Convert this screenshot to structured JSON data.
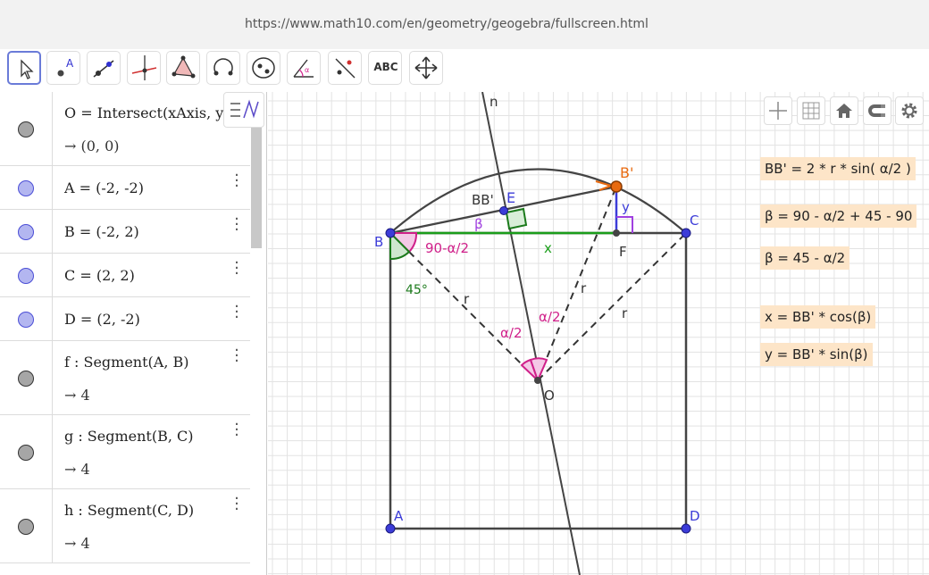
{
  "browser": {
    "url": "https://www.math10.com/en/geometry/geogebra/fullscreen.html"
  },
  "toolbar": {
    "tools": [
      {
        "icon": "move-arrow-icon"
      },
      {
        "icon": "point-icon"
      },
      {
        "icon": "line-icon"
      },
      {
        "icon": "perpendicular-icon"
      },
      {
        "icon": "polygon-icon"
      },
      {
        "icon": "arc-icon"
      },
      {
        "icon": "circle-icon"
      },
      {
        "icon": "angle-icon"
      },
      {
        "icon": "reflect-icon"
      },
      {
        "icon": "text-icon"
      },
      {
        "icon": "move-view-icon"
      }
    ],
    "text_tool_label": "ABC"
  },
  "algebra": {
    "rows": [
      {
        "def": "O = Intersect(xAxis, yAxis)",
        "value": "→  (0, 0)",
        "color": "gray"
      },
      {
        "def": "A = (-2, -2)",
        "color": "blue"
      },
      {
        "def": "B = (-2, 2)",
        "color": "blue"
      },
      {
        "def": "C = (2, 2)",
        "color": "blue"
      },
      {
        "def": "D = (2, -2)",
        "color": "blue"
      },
      {
        "def": "f : Segment(A, B)",
        "value": "→  4",
        "color": "gray"
      },
      {
        "def": "g : Segment(B, C)",
        "value": "→  4",
        "color": "gray"
      },
      {
        "def": "h : Segment(C, D)",
        "value": "→  4",
        "color": "gray"
      }
    ]
  },
  "graphics": {
    "labels": {
      "A": "A",
      "B": "B",
      "C": "C",
      "D": "D",
      "O": "O",
      "E": "E",
      "F": "F",
      "Bp": "B'",
      "n": "n",
      "BBp": "BB'",
      "beta": "β",
      "x": "x",
      "y": "y",
      "angleB": "90-α/2",
      "angle45": "45°",
      "r1": "r",
      "r2": "r",
      "r3": "r",
      "half1": "α/2",
      "half2": "α/2"
    },
    "notes": [
      "BB' = 2 * r * sin( α/2 )",
      "β = 90 - α/2 + 45 - 90",
      "β = 45 - α/2",
      "x = BB' * cos(β)",
      "y = BB' * sin(β)"
    ]
  },
  "colors": {
    "blue_point": "#3c3cd8",
    "orange_point": "#e86a10",
    "green": "#1b9e1b",
    "magenta": "#d0208a",
    "purple": "#a040e0",
    "grid": "#e3e3e3",
    "note_bg": "#fde5c8"
  }
}
